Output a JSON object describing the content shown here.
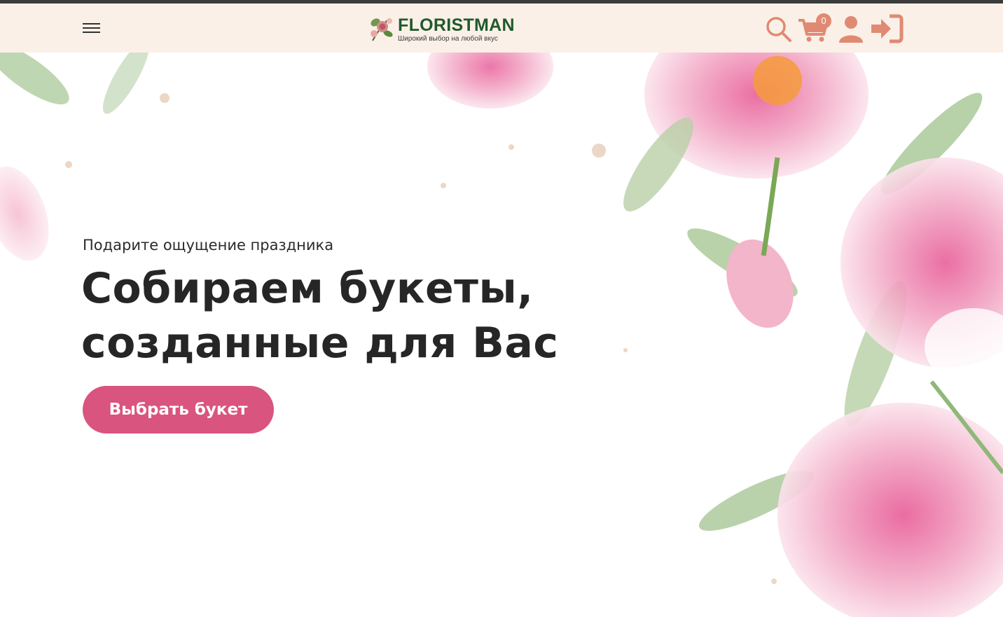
{
  "header": {
    "menu_icon": "hamburger-menu-icon",
    "logo": {
      "name": "FLORISTMAN",
      "tagline": "Широкий выбор на любой вкус"
    },
    "cart_count": "0",
    "icons": [
      "search-icon",
      "cart-icon",
      "user-icon",
      "login-icon"
    ],
    "accent_color": "#e08a73",
    "bg_color": "#fbf0e7"
  },
  "hero": {
    "subtitle": "Подарите ощущение праздника",
    "headline_line1": "Собираем букеты,",
    "headline_line2": "созданные для Вас",
    "cta_label": "Выбрать букет",
    "cta_color": "#d9547f"
  }
}
